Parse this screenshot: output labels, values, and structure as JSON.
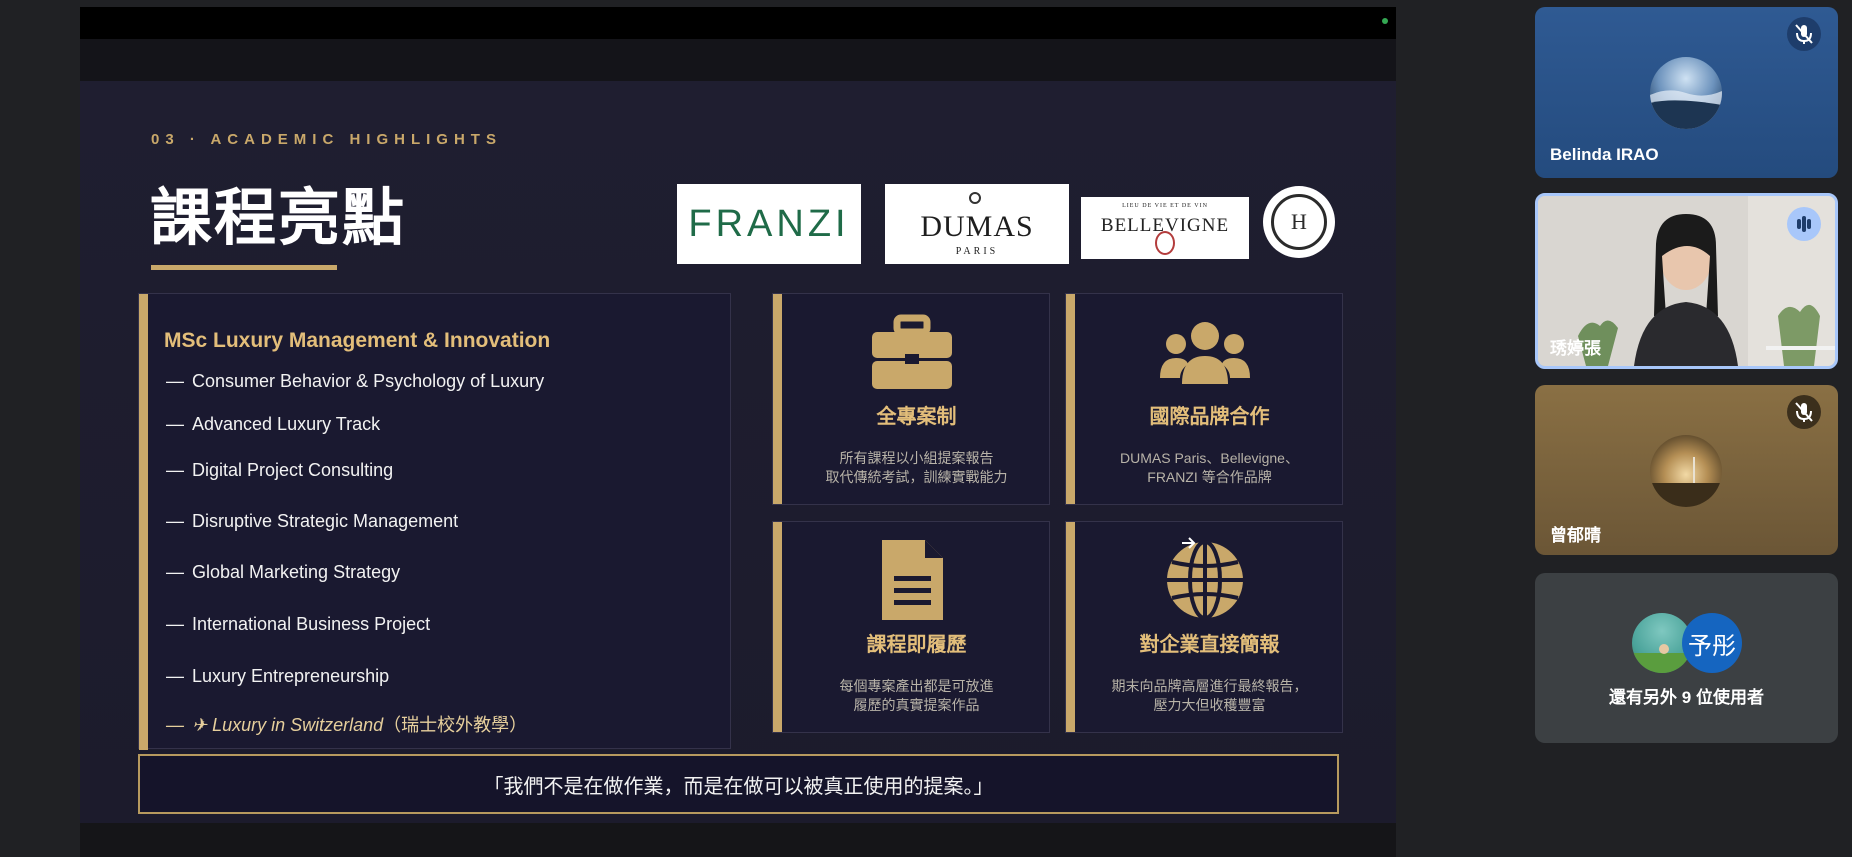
{
  "slide": {
    "kicker": "03 · ACADEMIC HIGHLIGHTS",
    "title": "課程亮點",
    "logos": {
      "franzi": "FRANZI",
      "dumas": "DUMAS",
      "dumas_city": "PARIS",
      "bellevigne": "BELLEVIGNE",
      "bellevigne_tag": "LIEU DE VIE ET DE VIN"
    },
    "course": {
      "heading": "MSc Luxury Management & Innovation",
      "items": [
        "Consumer Behavior & Psychology of Luxury",
        "Advanced Luxury Track",
        "Digital Project Consulting",
        "Disruptive Strategic Management",
        "Global Marketing Strategy",
        "International Business Project",
        "Luxury Entrepreneurship"
      ],
      "special_item": "✈ Luxury in Switzerland",
      "special_note": "（瑞士校外教學）"
    },
    "cards": [
      {
        "icon": "briefcase-icon",
        "title": "全專案制",
        "desc1": "所有課程以小組提案報告",
        "desc2": "取代傳統考試，訓練實戰能力"
      },
      {
        "icon": "users-icon",
        "title": "國際品牌合作",
        "desc1": "DUMAS Paris、Bellevigne、",
        "desc2": "FRANZI 等合作品牌"
      },
      {
        "icon": "document-icon",
        "title": "課程即履歷",
        "desc1": "每個專案產出都是可放進",
        "desc2": "履歷的真實提案作品"
      },
      {
        "icon": "globe-icon",
        "title": "對企業直接簡報",
        "desc1": "期末向品牌高層進行最終報告，",
        "desc2": "壓力大但收穫豐富"
      }
    ],
    "quote": "「我們不是在做作業，而是在做可以被真正使用的提案。」"
  },
  "participants": [
    {
      "name": "Belinda IRAO",
      "status": "muted"
    },
    {
      "name": "琇婷張",
      "status": "speaking"
    },
    {
      "name": "曾郁晴",
      "status": "muted"
    }
  ],
  "others": {
    "initial": "予彤",
    "label": "還有另外 9 位使用者"
  },
  "colors": {
    "accent_gold": "#c9a86a",
    "slide_bg": "#1f1e30",
    "meet_bg": "#202124"
  }
}
